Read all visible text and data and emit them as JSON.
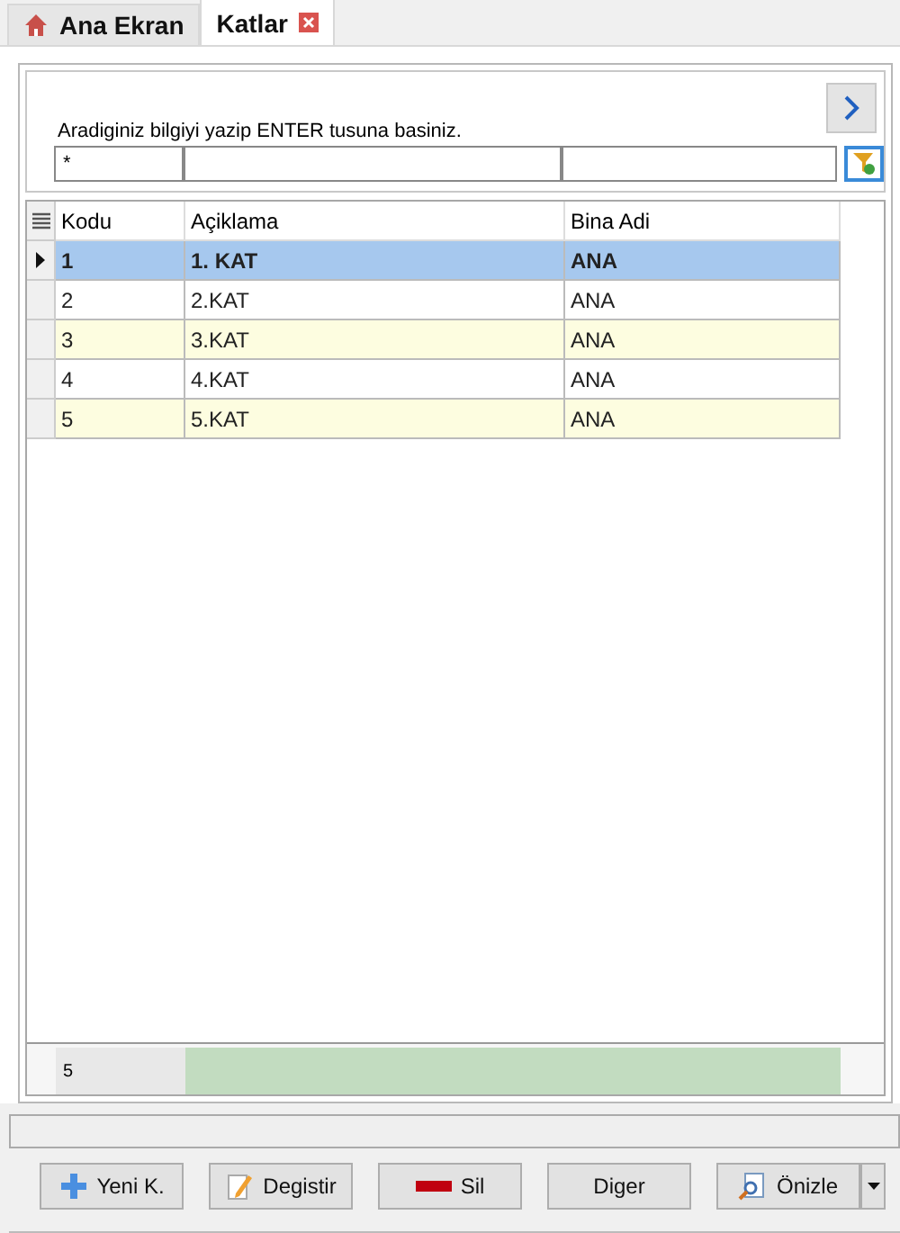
{
  "tabs": [
    {
      "label": "Ana Ekran",
      "kind": "home",
      "selected": false
    },
    {
      "label": "Katlar",
      "kind": "closable",
      "selected": true
    }
  ],
  "search": {
    "hint": "Aradiginiz bilgiyi yazip ENTER tusuna basiniz.",
    "value": "*"
  },
  "table": {
    "columns": [
      "Kodu",
      "Açiklama",
      "Bina Adi"
    ],
    "rows": [
      {
        "cells": [
          "1",
          "1. KAT",
          "ANA"
        ],
        "selected": true
      },
      {
        "cells": [
          "2",
          "2.KAT",
          "ANA"
        ],
        "selected": false
      },
      {
        "cells": [
          "3",
          "3.KAT",
          "ANA"
        ],
        "selected": false
      },
      {
        "cells": [
          "4",
          "4.KAT",
          "ANA"
        ],
        "selected": false
      },
      {
        "cells": [
          "5",
          "5.KAT",
          "ANA"
        ],
        "selected": false
      }
    ],
    "footer": {
      "count": "5"
    }
  },
  "buttons": [
    {
      "label": "Yeni K.",
      "kind": "plus"
    },
    {
      "label": "Degistir",
      "kind": "edit"
    },
    {
      "label": "Sil",
      "kind": "minus"
    },
    {
      "label": "Diger",
      "kind": "none"
    },
    {
      "label": "Önizle",
      "kind": "preview"
    }
  ]
}
